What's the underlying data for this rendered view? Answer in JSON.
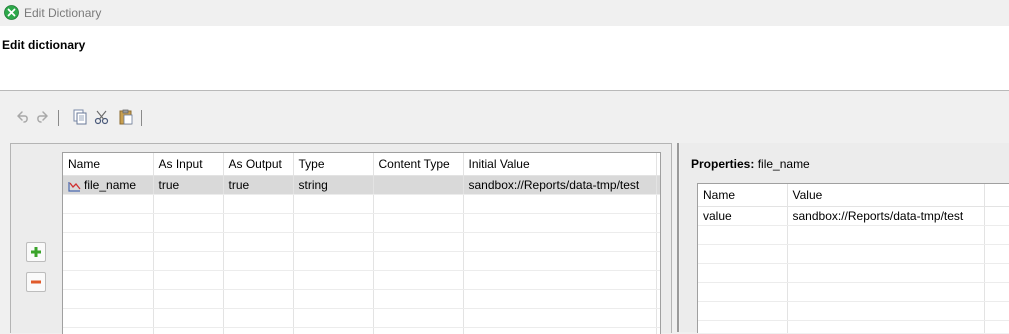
{
  "window": {
    "title": "Edit Dictionary",
    "icon": "green-x-circle-icon"
  },
  "header": {
    "title": "Edit dictionary"
  },
  "toolbar": {
    "buttons": [
      "undo-icon",
      "redo-icon",
      "copy-icon",
      "cut-icon",
      "paste-icon"
    ]
  },
  "side_buttons": [
    "add-icon",
    "remove-icon"
  ],
  "dictionary_table": {
    "columns": [
      "Name",
      "As Input",
      "As Output",
      "Type",
      "Content Type",
      "Initial Value"
    ],
    "rows": [
      {
        "name": "file_name",
        "as_input": "true",
        "as_output": "true",
        "type": "string",
        "content_type": "",
        "initial_value": "sandbox://Reports/data-tmp/test",
        "selected": true,
        "icon": "variable-icon"
      }
    ]
  },
  "properties": {
    "title_label": "Properties:",
    "title_value": "file_name",
    "columns": [
      "Name",
      "Value"
    ],
    "rows": [
      {
        "name": "value",
        "value": "sandbox://Reports/data-tmp/test"
      }
    ]
  },
  "colors": {
    "add": "#3aa32a",
    "remove": "#e05a2b",
    "selected_row": "#d9d9d9"
  }
}
